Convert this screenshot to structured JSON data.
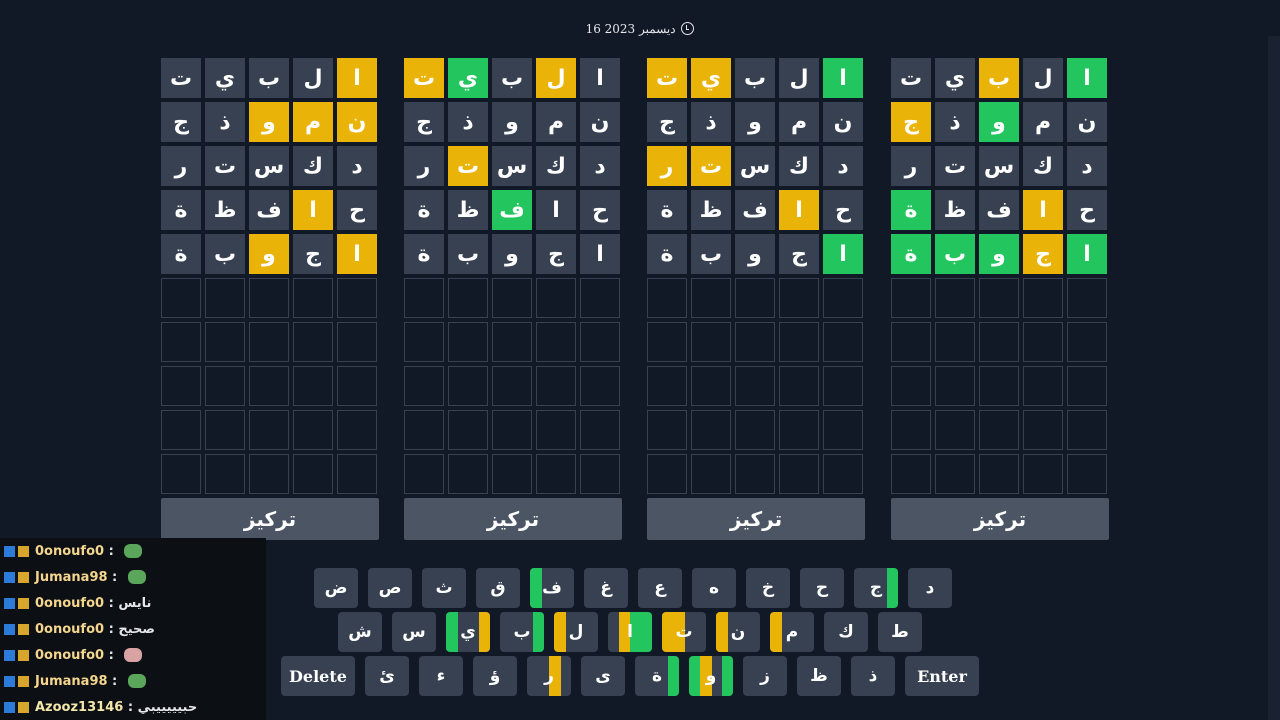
{
  "header": {
    "date": "16 ديسمبر 2023",
    "icon": "clock-icon"
  },
  "colors": {
    "absent": "#374151",
    "present": "#eab308",
    "correct": "#22c55e",
    "empty": "#111826"
  },
  "boards": [
    {
      "focus_label": "تركيز",
      "rows": [
        [
          [
            "ت",
            "n"
          ],
          [
            "ي",
            "n"
          ],
          [
            "ب",
            "n"
          ],
          [
            "ل",
            "n"
          ],
          [
            "ا",
            "y"
          ]
        ],
        [
          [
            "ج",
            "n"
          ],
          [
            "ذ",
            "n"
          ],
          [
            "و",
            "y"
          ],
          [
            "م",
            "y"
          ],
          [
            "ن",
            "y"
          ]
        ],
        [
          [
            "ر",
            "n"
          ],
          [
            "ت",
            "n"
          ],
          [
            "س",
            "n"
          ],
          [
            "ك",
            "n"
          ],
          [
            "د",
            "n"
          ]
        ],
        [
          [
            "ة",
            "n"
          ],
          [
            "ظ",
            "n"
          ],
          [
            "ف",
            "n"
          ],
          [
            "ا",
            "y"
          ],
          [
            "ح",
            "n"
          ]
        ],
        [
          [
            "ة",
            "n"
          ],
          [
            "ب",
            "n"
          ],
          [
            "و",
            "y"
          ],
          [
            "ج",
            "n"
          ],
          [
            "ا",
            "y"
          ]
        ]
      ]
    },
    {
      "focus_label": "تركيز",
      "rows": [
        [
          [
            "ت",
            "y"
          ],
          [
            "ي",
            "g"
          ],
          [
            "ب",
            "n"
          ],
          [
            "ل",
            "y"
          ],
          [
            "ا",
            "n"
          ]
        ],
        [
          [
            "ج",
            "n"
          ],
          [
            "ذ",
            "n"
          ],
          [
            "و",
            "n"
          ],
          [
            "م",
            "n"
          ],
          [
            "ن",
            "n"
          ]
        ],
        [
          [
            "ر",
            "n"
          ],
          [
            "ت",
            "y"
          ],
          [
            "س",
            "n"
          ],
          [
            "ك",
            "n"
          ],
          [
            "د",
            "n"
          ]
        ],
        [
          [
            "ة",
            "n"
          ],
          [
            "ظ",
            "n"
          ],
          [
            "ف",
            "g"
          ],
          [
            "ا",
            "n"
          ],
          [
            "ح",
            "n"
          ]
        ],
        [
          [
            "ة",
            "n"
          ],
          [
            "ب",
            "n"
          ],
          [
            "و",
            "n"
          ],
          [
            "ج",
            "n"
          ],
          [
            "ا",
            "n"
          ]
        ]
      ]
    },
    {
      "focus_label": "تركيز",
      "rows": [
        [
          [
            "ت",
            "y"
          ],
          [
            "ي",
            "y"
          ],
          [
            "ب",
            "n"
          ],
          [
            "ل",
            "n"
          ],
          [
            "ا",
            "g"
          ]
        ],
        [
          [
            "ج",
            "n"
          ],
          [
            "ذ",
            "n"
          ],
          [
            "و",
            "n"
          ],
          [
            "م",
            "n"
          ],
          [
            "ن",
            "n"
          ]
        ],
        [
          [
            "ر",
            "y"
          ],
          [
            "ت",
            "y"
          ],
          [
            "س",
            "n"
          ],
          [
            "ك",
            "n"
          ],
          [
            "د",
            "n"
          ]
        ],
        [
          [
            "ة",
            "n"
          ],
          [
            "ظ",
            "n"
          ],
          [
            "ف",
            "n"
          ],
          [
            "ا",
            "y"
          ],
          [
            "ح",
            "n"
          ]
        ],
        [
          [
            "ة",
            "n"
          ],
          [
            "ب",
            "n"
          ],
          [
            "و",
            "n"
          ],
          [
            "ج",
            "n"
          ],
          [
            "ا",
            "g"
          ]
        ]
      ]
    },
    {
      "focus_label": "تركيز",
      "rows": [
        [
          [
            "ت",
            "n"
          ],
          [
            "ي",
            "n"
          ],
          [
            "ب",
            "y"
          ],
          [
            "ل",
            "n"
          ],
          [
            "ا",
            "g"
          ]
        ],
        [
          [
            "ج",
            "y"
          ],
          [
            "ذ",
            "n"
          ],
          [
            "و",
            "g"
          ],
          [
            "م",
            "n"
          ],
          [
            "ن",
            "n"
          ]
        ],
        [
          [
            "ر",
            "n"
          ],
          [
            "ت",
            "n"
          ],
          [
            "س",
            "n"
          ],
          [
            "ك",
            "n"
          ],
          [
            "د",
            "n"
          ]
        ],
        [
          [
            "ة",
            "g"
          ],
          [
            "ظ",
            "n"
          ],
          [
            "ف",
            "n"
          ],
          [
            "ا",
            "y"
          ],
          [
            "ح",
            "n"
          ]
        ],
        [
          [
            "ة",
            "g"
          ],
          [
            "ب",
            "g"
          ],
          [
            "و",
            "g"
          ],
          [
            "ج",
            "y"
          ],
          [
            "ا",
            "g"
          ]
        ]
      ]
    }
  ],
  "empty_rows": 5,
  "keyboard": {
    "row1": [
      {
        "label": "ض"
      },
      {
        "label": "ص"
      },
      {
        "label": "ث"
      },
      {
        "label": "ق"
      },
      {
        "label": "ف",
        "marks": [
          "g"
        ]
      },
      {
        "label": "غ"
      },
      {
        "label": "ع"
      },
      {
        "label": "ه"
      },
      {
        "label": "خ"
      },
      {
        "label": "ح"
      },
      {
        "label": "ج",
        "marks": [
          "",
          "",
          "",
          "g"
        ]
      },
      {
        "label": "د"
      }
    ],
    "row2": [
      {
        "label": "ش"
      },
      {
        "label": "س"
      },
      {
        "label": "ي",
        "marks": [
          "g",
          "",
          "",
          "y"
        ]
      },
      {
        "label": "ب",
        "marks": [
          "",
          "",
          "",
          "g"
        ]
      },
      {
        "label": "ل",
        "marks": [
          "y"
        ]
      },
      {
        "label": "ا",
        "marks": [
          "",
          "y",
          "g",
          "g"
        ]
      },
      {
        "label": "ت",
        "marks": [
          "y",
          "y"
        ]
      },
      {
        "label": "ن",
        "marks": [
          "y"
        ]
      },
      {
        "label": "م",
        "marks": [
          "y"
        ]
      },
      {
        "label": "ك"
      },
      {
        "label": "ط"
      }
    ],
    "row3": [
      {
        "label": "Delete",
        "wide": true
      },
      {
        "label": "ئ"
      },
      {
        "label": "ء"
      },
      {
        "label": "ؤ"
      },
      {
        "label": "ر",
        "marks": [
          "",
          "",
          "y"
        ]
      },
      {
        "label": "ى"
      },
      {
        "label": "ة",
        "marks": [
          "",
          "",
          "",
          "g"
        ]
      },
      {
        "label": "و",
        "marks": [
          "g",
          "y",
          "",
          "g"
        ]
      },
      {
        "label": "ز"
      },
      {
        "label": "ظ"
      },
      {
        "label": "ذ"
      },
      {
        "label": "Enter",
        "wide": true
      }
    ]
  },
  "chat": [
    {
      "user": "0onoufo0",
      "message": "",
      "emote": "green"
    },
    {
      "user": "Jumana98",
      "message": "",
      "emote": "green"
    },
    {
      "user": "0onoufo0",
      "message": "نايس"
    },
    {
      "user": "0onoufo0",
      "message": "صحيح"
    },
    {
      "user": "0onoufo0",
      "message": "",
      "emote": "pink"
    },
    {
      "user": "Jumana98",
      "message": "",
      "emote": "green"
    },
    {
      "user": "Azooz13146",
      "message": "حبيييييبي"
    }
  ]
}
